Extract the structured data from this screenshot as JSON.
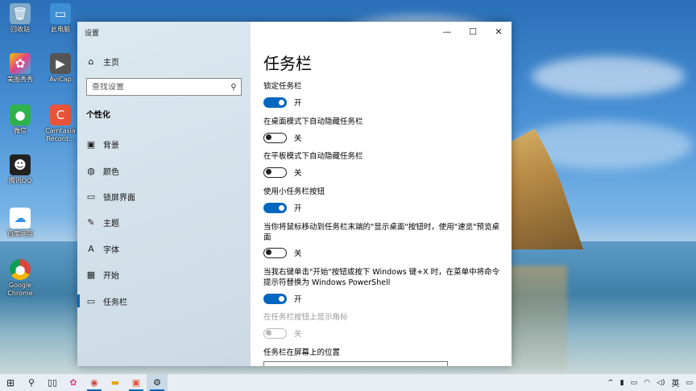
{
  "desktop": {
    "icons": [
      {
        "label": "回收站",
        "icon": "recycle-bin-icon",
        "color": "#7fa9c9"
      },
      {
        "label": "此电脑",
        "icon": "computer-icon",
        "color": "#3f8fd6"
      },
      {
        "label": "美图秀秀",
        "icon": "meitu-icon",
        "color": "#e0418a"
      },
      {
        "label": "AviCap",
        "icon": "avicap-icon",
        "color": "#555555"
      },
      {
        "label": "微信",
        "icon": "wechat-icon",
        "color": "#2fb24c"
      },
      {
        "label": "Camtasia Record...",
        "icon": "camtasia-icon",
        "color": "#e8533a"
      },
      {
        "label": "腾讯QQ",
        "icon": "qq-icon",
        "color": "#222222"
      },
      {
        "label": "百度网盘",
        "icon": "baidu-netdisk-icon",
        "color": "#2f8fe0"
      },
      {
        "label": "Google Chrome",
        "icon": "chrome-icon",
        "color": "#e0b000"
      }
    ]
  },
  "window": {
    "title": "设置",
    "controls": {
      "minimize": "—",
      "maximize": "☐",
      "close": "✕"
    }
  },
  "sidebar": {
    "home": {
      "label": "主页",
      "icon": "home-icon"
    },
    "search": {
      "placeholder": "查找设置",
      "icon": "search-icon"
    },
    "section": "个性化",
    "items": [
      {
        "label": "背景",
        "icon": "image-icon",
        "glyph": "▣"
      },
      {
        "label": "颜色",
        "icon": "palette-icon",
        "glyph": "◍"
      },
      {
        "label": "锁屏界面",
        "icon": "lock-screen-icon",
        "glyph": "▭"
      },
      {
        "label": "主题",
        "icon": "brush-icon",
        "glyph": "✎"
      },
      {
        "label": "字体",
        "icon": "font-icon",
        "glyph": "A"
      },
      {
        "label": "开始",
        "icon": "start-icon",
        "glyph": "▦"
      },
      {
        "label": "任务栏",
        "icon": "taskbar-icon",
        "glyph": "▭"
      }
    ],
    "active_item": "任务栏"
  },
  "main": {
    "title": "任务栏",
    "options": [
      {
        "label": "锁定任务栏",
        "state": "on",
        "state_label": "开"
      },
      {
        "label": "在桌面模式下自动隐藏任务栏",
        "state": "off",
        "state_label": "关"
      },
      {
        "label": "在平板模式下自动隐藏任务栏",
        "state": "off",
        "state_label": "关"
      },
      {
        "label": "使用小任务栏按钮",
        "state": "on",
        "state_label": "开"
      },
      {
        "label": "当你将鼠标移动到任务栏末端的\"显示桌面\"按钮时，使用\"速览\"预览桌面",
        "state": "off",
        "state_label": "关"
      },
      {
        "label": "当我右键单击\"开始\"按钮或按下 Windows 键+X 时，在菜单中将命令提示符替换为 Windows PowerShell",
        "state": "on",
        "state_label": "开"
      },
      {
        "label": "在任务栏按钮上显示角标",
        "state": "disabled",
        "state_label": "关"
      }
    ],
    "position_label": "任务栏在屏幕上的位置"
  },
  "taskbar": {
    "items": [
      "windows-start-icon",
      "search-icon",
      "task-view-icon",
      "app-icon",
      "chrome-icon",
      "file-explorer-icon",
      "camtasia-icon",
      "settings-icon"
    ],
    "tray": {
      "input_method": "英"
    },
    "accent": "#0067c0"
  }
}
